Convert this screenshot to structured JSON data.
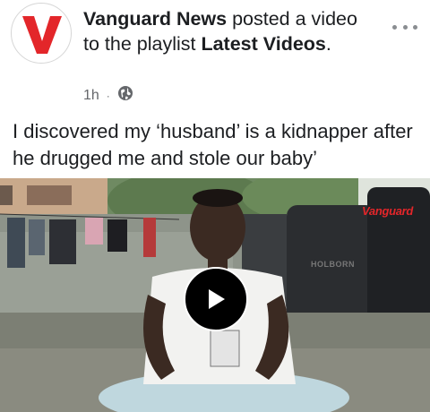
{
  "post": {
    "page_name": "Vanguard News",
    "action_text": " posted a video to the playlist ",
    "playlist_name": "Latest Videos",
    "period": ".",
    "timestamp": "1h",
    "separator": "·",
    "audience_icon": "globe-icon",
    "more_icon": "more-options-icon"
  },
  "caption": "I discovered my ‘husband’ is a kidnapper after he drugged me and stole our baby’",
  "video": {
    "watermark": "Vanguard",
    "tank_label": "HOLBORN",
    "play_icon": "play-icon"
  },
  "colors": {
    "brand_red": "#e3262a",
    "meta_gray": "#65676b",
    "text": "#1c1e21"
  }
}
